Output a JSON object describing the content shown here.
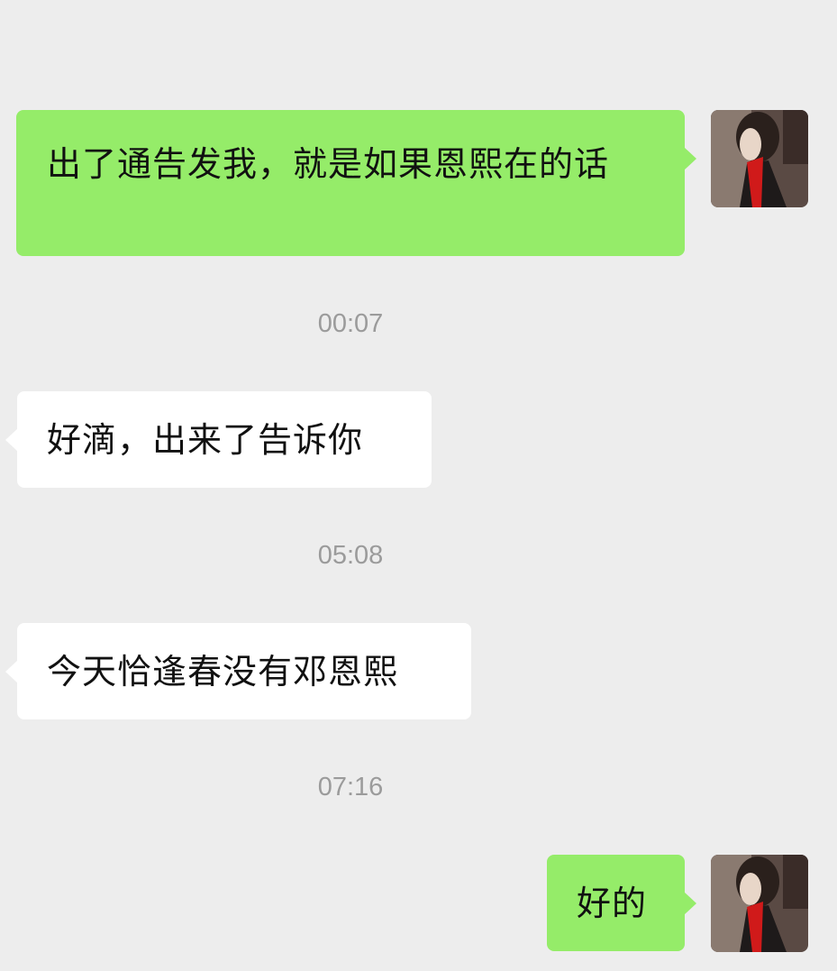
{
  "messages": [
    {
      "id": "m1",
      "side": "sent",
      "text": "出了通告发我，就是如果恩熙在的话"
    },
    {
      "id": "t1",
      "type": "timestamp",
      "text": "00:07"
    },
    {
      "id": "m2",
      "side": "received",
      "text": "好滴，出来了告诉你"
    },
    {
      "id": "t2",
      "type": "timestamp",
      "text": "05:08"
    },
    {
      "id": "m3",
      "side": "received",
      "text": "今天恰逢春没有邓恩熙"
    },
    {
      "id": "t3",
      "type": "timestamp",
      "text": "07:16"
    },
    {
      "id": "m4",
      "side": "sent",
      "text": "好的"
    }
  ],
  "colors": {
    "background": "#ededed",
    "sent_bubble": "#95ec69",
    "received_bubble": "#ffffff",
    "timestamp_text": "#9b9b9b",
    "message_text": "#111111"
  },
  "icons": {
    "avatar": "user-avatar-photo"
  }
}
